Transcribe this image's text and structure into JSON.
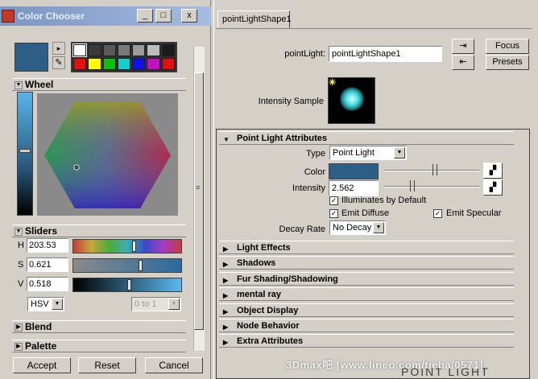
{
  "chooser": {
    "title": "Color Chooser",
    "title_buttons": [
      "_",
      "□",
      "x"
    ],
    "current_color": "#2d5e85",
    "palette": [
      "#ffffff",
      "#3a3a3a",
      "#5a5a5a",
      "#7a7a7a",
      "#9a9a9a",
      "#bdbdbd",
      "#1a1a1a",
      "#e01010",
      "#ffff00",
      "#10c010",
      "#10d0d0",
      "#1010e0",
      "#c010c0",
      "#e01010"
    ],
    "wheel_header": "Wheel",
    "sliders_header": "Sliders",
    "sliders": [
      {
        "label": "H",
        "value": "203.53",
        "position": 0.56
      },
      {
        "label": "S",
        "value": "0.621",
        "position": 0.621
      },
      {
        "label": "V",
        "value": "0.518",
        "position": 0.518
      }
    ],
    "mode": "HSV",
    "range": "0 to 1",
    "blend_header": "Blend",
    "palette_header": "Palette",
    "buttons": {
      "accept": "Accept",
      "reset": "Reset",
      "cancel": "Cancel"
    },
    "scroll_grip": "≡"
  },
  "attr": {
    "tab": "pointLightShape1",
    "point_light_label": "pointLight:",
    "point_light_value": "pointLightShape1",
    "focus_label": "Focus",
    "presets_label": "Presets",
    "load_icon": "⇥",
    "save_icon": "⇤",
    "intensity_sample_label": "Intensity Sample",
    "sample_spark": "✳",
    "section_point": "Point Light Attributes",
    "type_label": "Type",
    "type_value": "Point Light",
    "color_label": "Color",
    "color_value": "#2d5e85",
    "intensity_label": "Intensity",
    "intensity_value": "2.562",
    "map_icon": "▞",
    "illuminates_label": "Illuminates by Default",
    "emit_diffuse_label": "Emit Diffuse",
    "emit_specular_label": "Emit Specular",
    "check_mark": "✓",
    "decay_label": "Decay Rate",
    "decay_value": "No Decay",
    "sections": [
      "Light Effects",
      "Shadows",
      "Fur Shading/Shadowing",
      "mental ray",
      "Object Display",
      "Node Behavior",
      "Extra Attributes"
    ]
  },
  "watermark": {
    "text": "3Dmax吧 [www.lineo.com/tieba/0571]",
    "text2": "POINT LIGHT"
  },
  "glyphs": {
    "down": "▼",
    "right": "▶",
    "arrow_right": "▸",
    "picker": "✎"
  }
}
